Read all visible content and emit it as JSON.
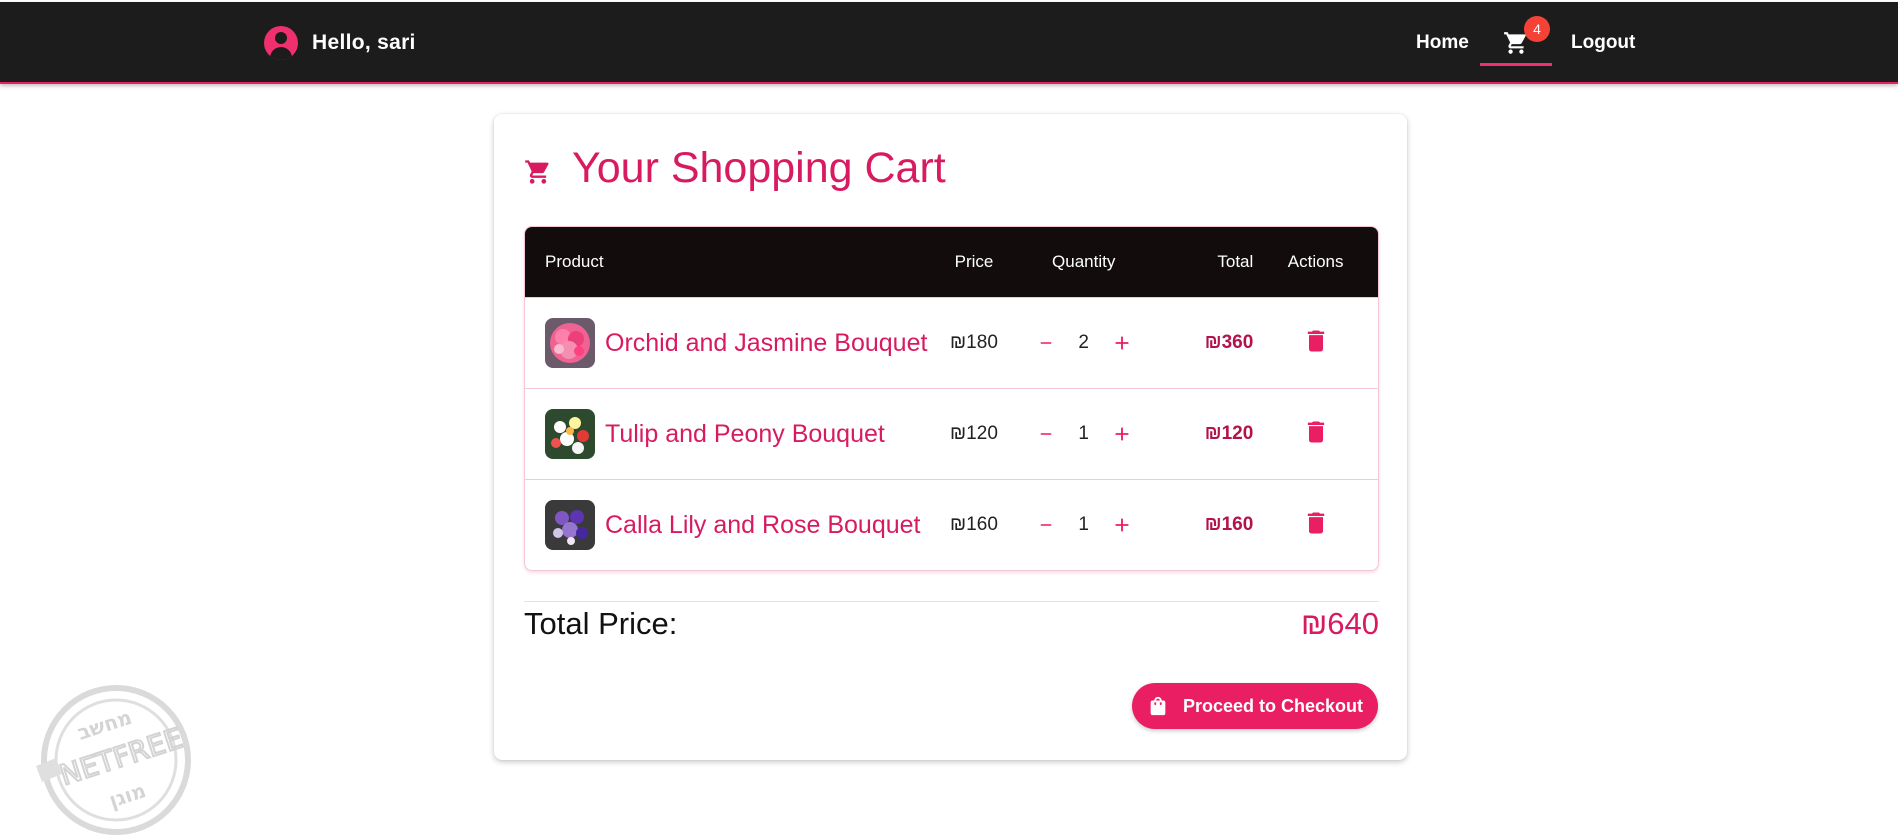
{
  "nav": {
    "greeting": "Hello, sari",
    "home_label": "Home",
    "cart_count": "4",
    "logout_label": "Logout"
  },
  "cart": {
    "title": "Your Shopping Cart",
    "columns": {
      "product": "Product",
      "price": "Price",
      "quantity": "Quantity",
      "total": "Total",
      "actions": "Actions"
    },
    "items": [
      {
        "name": "Orchid and Jasmine Bouquet",
        "price": "₪180",
        "quantity": "2",
        "total": "₪360"
      },
      {
        "name": "Tulip and Peony Bouquet",
        "price": "₪120",
        "quantity": "1",
        "total": "₪120"
      },
      {
        "name": "Calla Lily and Rose Bouquet",
        "price": "₪160",
        "quantity": "1",
        "total": "₪160"
      }
    ],
    "total_label": "Total Price:",
    "total_value": "₪640",
    "checkout_label": "Proceed to Checkout"
  },
  "colors": {
    "accent": "#e91e63",
    "accent_dark": "#d81b60",
    "navbar": "#1c1c1c",
    "table_header": "#120c0c",
    "badge": "#f44336"
  },
  "icons": [
    "account-circle-icon",
    "shopping-cart-icon",
    "remove-icon",
    "add-icon",
    "delete-icon",
    "shopping-bag-icon"
  ],
  "watermark": {
    "top_text": "מחשב",
    "middle_text": "NETFREE",
    "bottom_text": "מוגן"
  }
}
